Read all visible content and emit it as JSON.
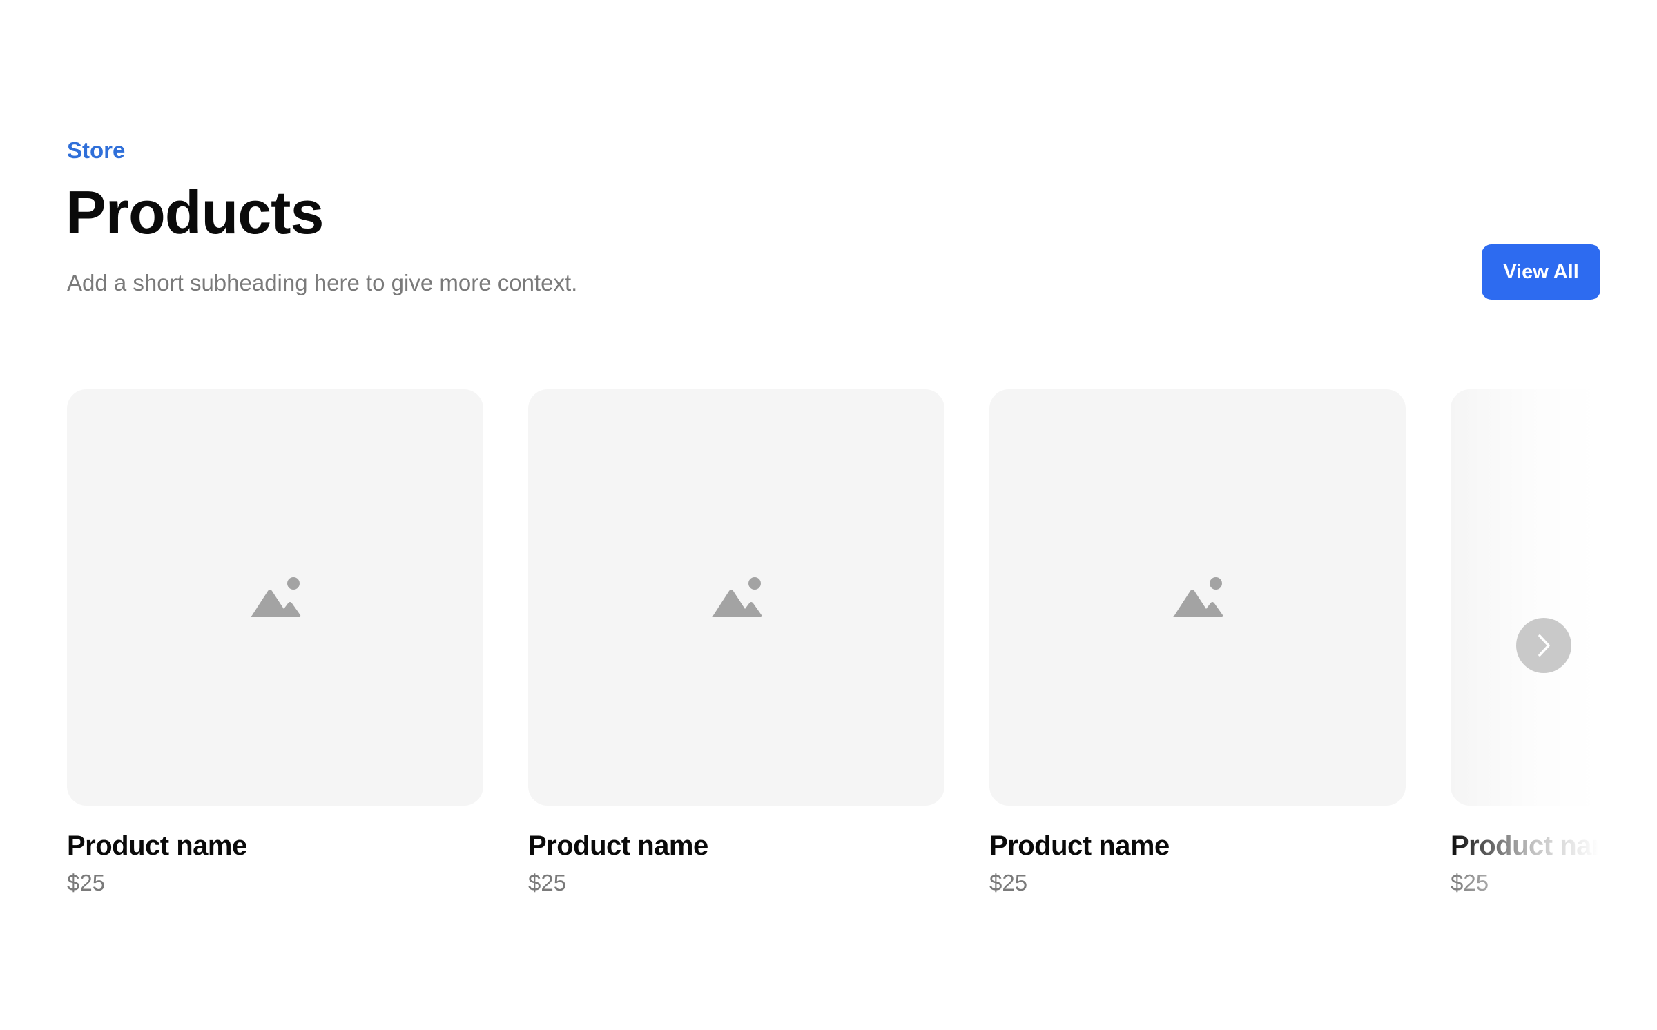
{
  "header": {
    "eyebrow": "Store",
    "title": "Products",
    "subheading": "Add a short subheading here to give more context.",
    "view_all_label": "View All"
  },
  "colors": {
    "accent": "#2d6bf0",
    "eyebrow": "#2f6fd9",
    "placeholder_bg": "#f5f5f5",
    "icon": "#a3a3a3"
  },
  "products": [
    {
      "name": "Product name",
      "price": "$25",
      "icon": "image-placeholder-icon"
    },
    {
      "name": "Product name",
      "price": "$25",
      "icon": "image-placeholder-icon"
    },
    {
      "name": "Product name",
      "price": "$25",
      "icon": "image-placeholder-icon"
    },
    {
      "name": "Product name",
      "price": "$25",
      "icon": "image-placeholder-icon"
    }
  ],
  "carousel": {
    "next_icon": "chevron-right-icon"
  }
}
